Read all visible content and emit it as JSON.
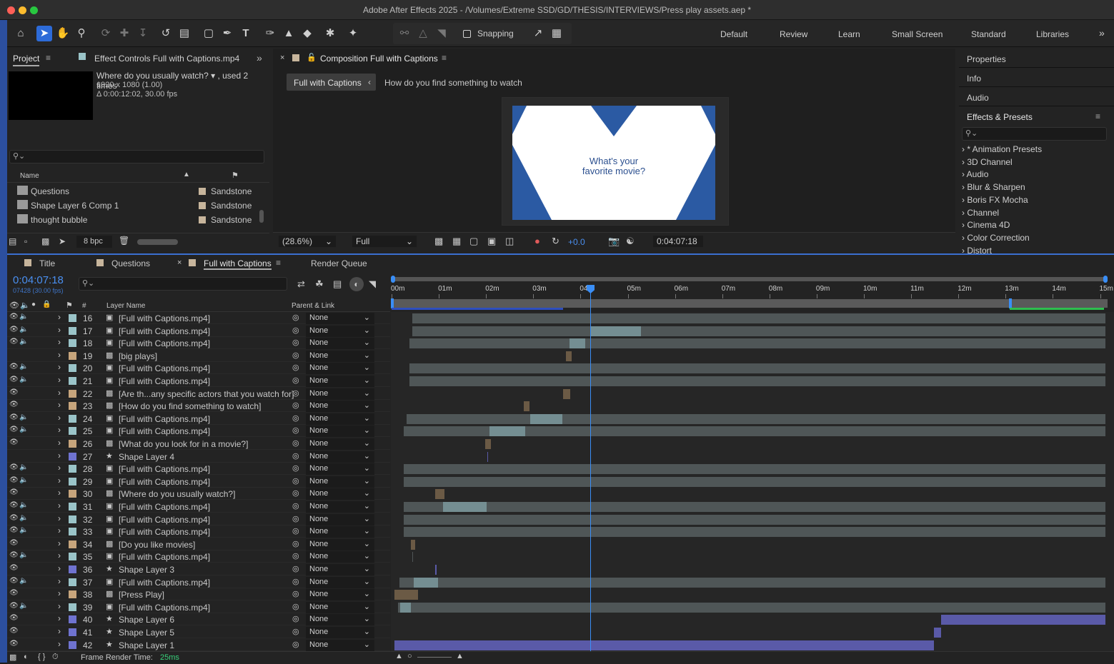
{
  "window": {
    "title": "Adobe After Effects 2025 - /Volumes/Extreme SSD/GD/THESIS/INTERVIEWS/Press play assets.aep *"
  },
  "toolbar": {
    "snapping": "Snapping",
    "workspaces": [
      "Default",
      "Review",
      "Learn",
      "Small Screen",
      "Standard",
      "Libraries"
    ]
  },
  "project": {
    "tab": "Project",
    "effect_controls": "Effect Controls Full with Captions.mp4",
    "item_name": "Where do you usually watch? ▾ , used 2 times",
    "item_size": "1920 x 1080 (1.00)",
    "item_duration": "Δ 0:00:12:02, 30.00 fps",
    "col_name": "Name",
    "bpc": "8 bpc",
    "items": [
      {
        "name": "Questions",
        "label": "Sandstone"
      },
      {
        "name": "Shape Layer 6 Comp 1",
        "label": "Sandstone"
      },
      {
        "name": "thought bubble",
        "label": "Sandstone"
      }
    ]
  },
  "composition": {
    "tab": "Composition Full with Captions",
    "crumb_active": "Full with Captions",
    "crumb_next": "How do you find something to watch",
    "preview_line1": "What's your",
    "preview_line2": "favorite movie?",
    "zoom": "(28.6%)",
    "resolution": "Full",
    "exposure": "+0.0",
    "timecode": "0:04:07:18"
  },
  "right_panel": {
    "items": [
      "Properties",
      "Info",
      "Audio",
      "Effects & Presets"
    ],
    "effects": [
      "* Animation Presets",
      "3D Channel",
      "Audio",
      "Blur & Sharpen",
      "Boris FX Mocha",
      "Channel",
      "Cinema 4D",
      "Color Correction",
      "Distort"
    ]
  },
  "timeline": {
    "tabs": [
      "Title",
      "Questions",
      "Full with Captions",
      "Render Queue"
    ],
    "timecode": "0:04:07:18",
    "frames": "07428 (30.00 fps)",
    "col_hash": "#",
    "col_layer": "Layer Name",
    "col_parent": "Parent & Link",
    "ruler": [
      "00m",
      "01m",
      "02m",
      "03m",
      "04m",
      "05m",
      "06m",
      "07m",
      "08m",
      "09m",
      "10m",
      "11m",
      "12m",
      "13m",
      "14m",
      "15m"
    ],
    "render_time_label": "Frame Render Time:",
    "render_time": "25ms",
    "layers": [
      {
        "n": "16",
        "name": "[Full with Captions.mp4]",
        "parent": "None"
      },
      {
        "n": "17",
        "name": "[Full with Captions.mp4]",
        "parent": "None"
      },
      {
        "n": "18",
        "name": "[Full with Captions.mp4]",
        "parent": "None"
      },
      {
        "n": "19",
        "name": "[big plays]",
        "parent": "None"
      },
      {
        "n": "20",
        "name": "[Full with Captions.mp4]",
        "parent": "None"
      },
      {
        "n": "21",
        "name": "[Full with Captions.mp4]",
        "parent": "None"
      },
      {
        "n": "22",
        "name": "[Are th...any specific actors that you watch for]",
        "parent": "None"
      },
      {
        "n": "23",
        "name": "[How do you find something to watch]",
        "parent": "None"
      },
      {
        "n": "24",
        "name": "[Full with Captions.mp4]",
        "parent": "None"
      },
      {
        "n": "25",
        "name": "[Full with Captions.mp4]",
        "parent": "None"
      },
      {
        "n": "26",
        "name": "[What do you look for in a movie?]",
        "parent": "None"
      },
      {
        "n": "27",
        "name": "Shape Layer 4",
        "parent": "None"
      },
      {
        "n": "28",
        "name": "[Full with Captions.mp4]",
        "parent": "None"
      },
      {
        "n": "29",
        "name": "[Full with Captions.mp4]",
        "parent": "None"
      },
      {
        "n": "30",
        "name": "[Where do you usually watch?]",
        "parent": "None"
      },
      {
        "n": "31",
        "name": "[Full with Captions.mp4]",
        "parent": "None"
      },
      {
        "n": "32",
        "name": "[Full with Captions.mp4]",
        "parent": "None"
      },
      {
        "n": "33",
        "name": "[Full with Captions.mp4]",
        "parent": "None"
      },
      {
        "n": "34",
        "name": "[Do you like movies]",
        "parent": "None"
      },
      {
        "n": "35",
        "name": "[Full with Captions.mp4]",
        "parent": "None"
      },
      {
        "n": "36",
        "name": "Shape Layer 3",
        "parent": "None"
      },
      {
        "n": "37",
        "name": "[Full with Captions.mp4]",
        "parent": "None"
      },
      {
        "n": "38",
        "name": "[Press Play]",
        "parent": "None"
      },
      {
        "n": "39",
        "name": "[Full with Captions.mp4]",
        "parent": "None"
      },
      {
        "n": "40",
        "name": "Shape Layer 6",
        "parent": "None"
      },
      {
        "n": "41",
        "name": "Shape Layer 5",
        "parent": "None"
      },
      {
        "n": "42",
        "name": "Shape Layer 1",
        "parent": "None"
      }
    ]
  }
}
